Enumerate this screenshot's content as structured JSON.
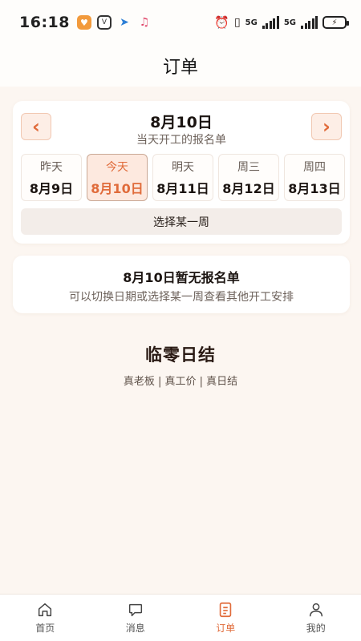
{
  "status_bar": {
    "time": "16:18",
    "signal1": "5G",
    "signal2": "5G"
  },
  "header": {
    "title": "订单"
  },
  "date_picker": {
    "prev_label": "‹",
    "next_label": "›",
    "current_date": "8月10日",
    "subtitle": "当天开工的报名单",
    "days": [
      {
        "name": "昨天",
        "date": "8月9日"
      },
      {
        "name": "今天",
        "date": "8月10日"
      },
      {
        "name": "明天",
        "date": "8月11日"
      },
      {
        "name": "周三",
        "date": "8月12日"
      },
      {
        "name": "周四",
        "date": "8月13日"
      }
    ],
    "selected_index": 1,
    "week_button": "选择某一周"
  },
  "empty_state": {
    "title": "8月10日暂无报名单",
    "description": "可以切换日期或选择某一周查看其他开工安排"
  },
  "brand": {
    "title": "临零日结",
    "tagline": "真老板 | 真工价 | 真日结"
  },
  "bottom_nav": {
    "items": [
      {
        "label": "首页",
        "icon": "home-icon"
      },
      {
        "label": "消息",
        "icon": "message-icon"
      },
      {
        "label": "订单",
        "icon": "order-icon"
      },
      {
        "label": "我的",
        "icon": "profile-icon"
      }
    ],
    "active_index": 2
  },
  "colors": {
    "accent": "#e06b3a",
    "background": "#fcf6f1",
    "card": "#ffffff"
  }
}
